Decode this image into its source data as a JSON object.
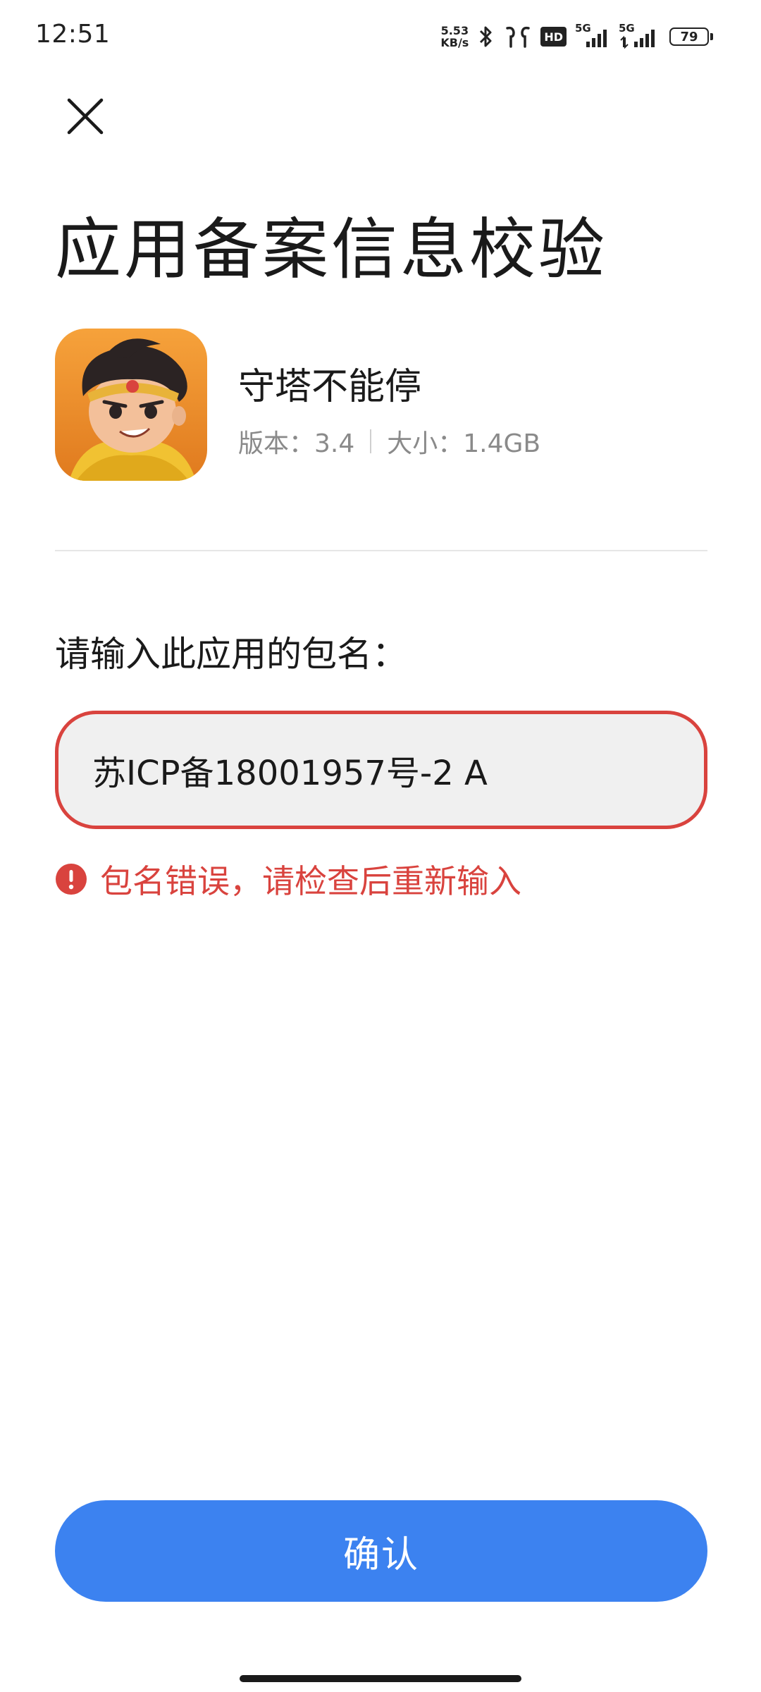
{
  "status_bar": {
    "time": "12:51",
    "net_speed_value": "5.53",
    "net_speed_unit": "KB/s",
    "hd_label": "HD",
    "signal1_label": "5G",
    "signal2_label": "5G",
    "battery_level": "79"
  },
  "page": {
    "title": "应用备案信息校验"
  },
  "app": {
    "name": "守塔不能停",
    "version": "版本：3.4",
    "size": "大小：1.4GB"
  },
  "form": {
    "prompt": "请输入此应用的包名：",
    "input_value": "苏ICP备18001957号-2 A",
    "error_message": "包名错误，请检查后重新输入"
  },
  "actions": {
    "confirm_label": "确认"
  },
  "colors": {
    "accent": "#3c82f0",
    "error": "#d9433e"
  }
}
